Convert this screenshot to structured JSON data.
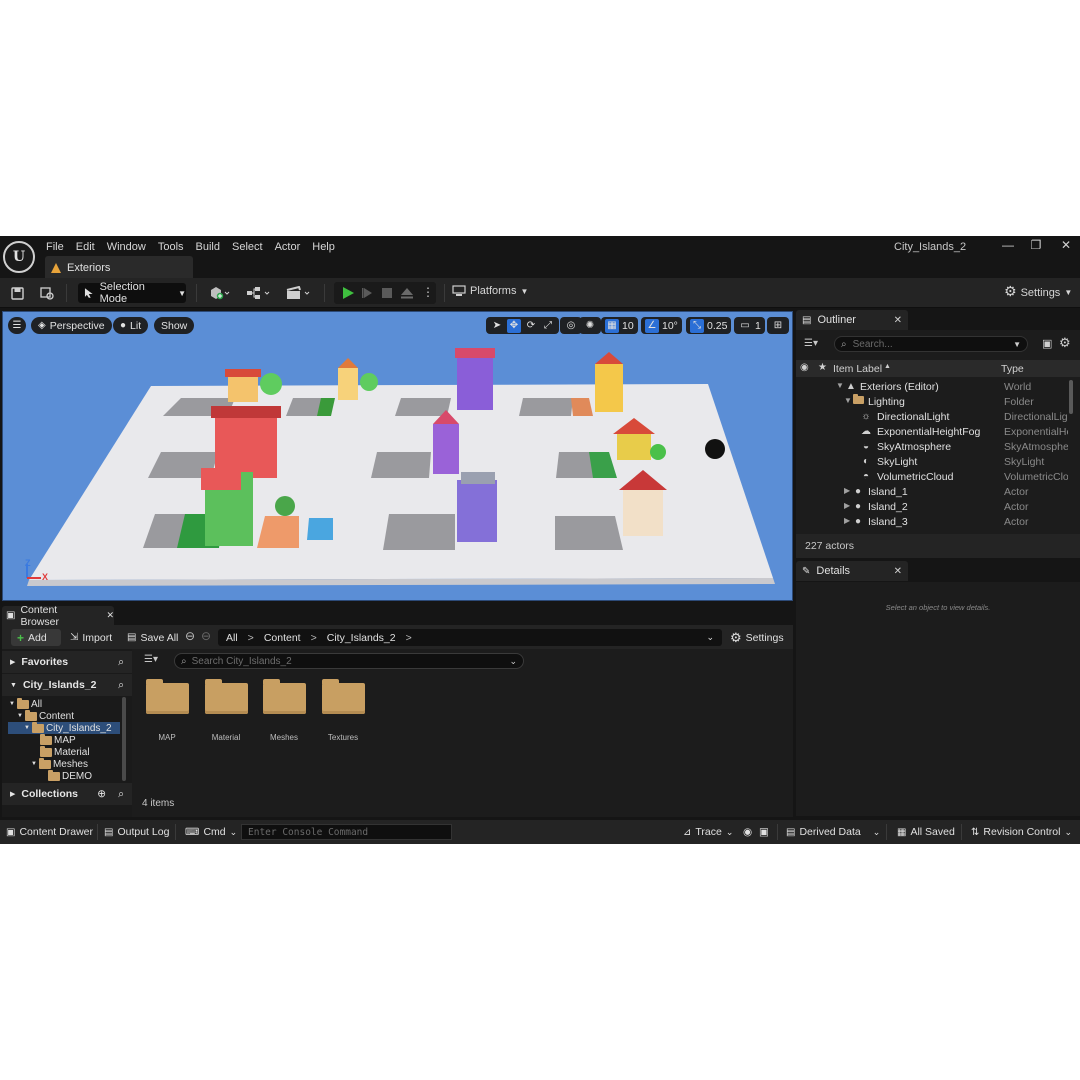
{
  "app": {
    "menu": [
      "File",
      "Edit",
      "Window",
      "Tools",
      "Build",
      "Select",
      "Actor",
      "Help"
    ],
    "project_name": "City_Islands_2",
    "level_tab": "Exteriors",
    "window_buttons": [
      "—",
      "❐",
      "✕"
    ]
  },
  "toolbar": {
    "selection_mode": "Selection Mode",
    "platforms": "Platforms",
    "settings": "Settings"
  },
  "viewport": {
    "view_mode": "Perspective",
    "lighting": "Lit",
    "show": "Show",
    "grid_snap": "10",
    "rotation_snap": "10°",
    "scale_snap": "0.25",
    "camera_speed": "1",
    "axis_z": "Z",
    "axis_x": "X",
    "sky_color": "#5b8ed6",
    "floor_color": "#e9e9ec"
  },
  "outliner": {
    "tab": "Outliner",
    "search_placeholder": "Search...",
    "col_label": "Item Label",
    "col_type": "Type",
    "rows": [
      {
        "label": "Exteriors (Editor)",
        "type": "World"
      },
      {
        "label": "Lighting",
        "type": "Folder"
      },
      {
        "label": "DirectionalLight",
        "type": "DirectionalLight"
      },
      {
        "label": "ExponentialHeightFog",
        "type": "ExponentialHeightFog"
      },
      {
        "label": "SkyAtmosphere",
        "type": "SkyAtmosphere"
      },
      {
        "label": "SkyLight",
        "type": "SkyLight"
      },
      {
        "label": "VolumetricCloud",
        "type": "VolumetricCloud"
      },
      {
        "label": "Island_1",
        "type": "Actor"
      },
      {
        "label": "Island_2",
        "type": "Actor"
      },
      {
        "label": "Island_3",
        "type": "Actor"
      }
    ],
    "actor_count": "227 actors"
  },
  "details": {
    "tab": "Details",
    "empty_message": "Select an object to view details."
  },
  "content_browser": {
    "tab": "Content Browser",
    "add": "Add",
    "import": "Import",
    "save_all": "Save All",
    "breadcrumb": [
      "All",
      "Content",
      "City_Islands_2"
    ],
    "settings": "Settings",
    "favorites": "Favorites",
    "project_section": "City_Islands_2",
    "collections": "Collections",
    "tree": [
      "All",
      "Content",
      "City_Islands_2",
      "MAP",
      "Material",
      "Meshes",
      "DEMO"
    ],
    "search_placeholder": "Search City_Islands_2",
    "folders": [
      "MAP",
      "Material",
      "Meshes",
      "Textures"
    ],
    "item_count": "4 items"
  },
  "statusbar": {
    "content_drawer": "Content Drawer",
    "output_log": "Output Log",
    "cmd": "Cmd",
    "console_placeholder": "Enter Console Command",
    "trace": "Trace",
    "derived_data": "Derived Data",
    "all_saved": "All Saved",
    "revision_control": "Revision Control"
  }
}
